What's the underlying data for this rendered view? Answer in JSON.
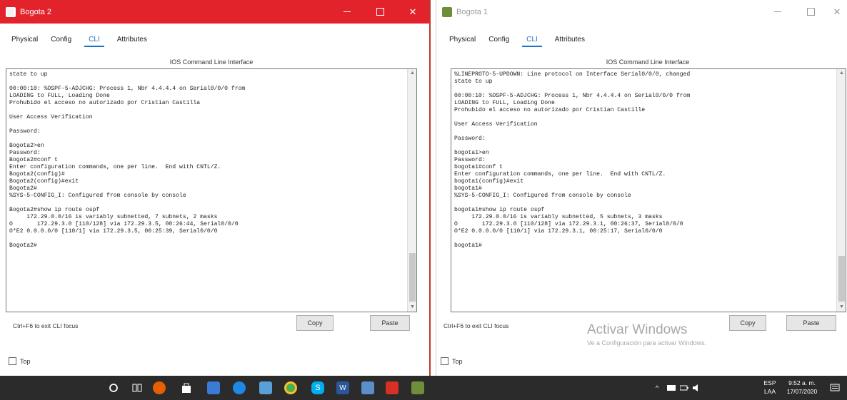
{
  "left_window": {
    "title": "Bogota 2",
    "controls": {
      "minimize": "—",
      "maximize": "□",
      "close": "✕"
    },
    "tabs": [
      "Physical",
      "Config",
      "CLI",
      "Attributes"
    ],
    "selected_tab": "CLI",
    "cli_caption": "IOS Command Line Interface",
    "terminal_lines": [
      "state to up",
      "",
      "00:00:10: %OSPF-5-ADJCHG: Process 1, Nbr 4.4.4.4 on Serial0/0/0 from",
      "LOADING to FULL, Loading Done",
      "Prohubido el acceso no autorizado por Cristian Castilla",
      "",
      "User Access Verification",
      "",
      "Password:",
      "",
      "Bogota2>en",
      "Password:",
      "Bogota2#conf t",
      "Enter configuration commands, one per line.  End with CNTL/Z.",
      "Bogota2(config)#",
      "Bogota2(config)#exit",
      "Bogota2#",
      "%SYS-5-CONFIG_I: Configured from console by console",
      "",
      "Bogota2#show ip route ospf",
      "     172.29.0.0/16 is variably subnetted, 7 subnets, 2 masks",
      "O       172.29.3.0 [110/128] via 172.29.3.5, 00:26:44, Serial0/0/0",
      "O*E2 0.0.0.0/0 [110/1] via 172.29.3.5, 00:25:39, Serial0/0/0",
      "",
      "Bogota2#"
    ],
    "hint": "Ctrl+F6 to exit CLI focus",
    "copy_label": "Copy",
    "paste_label": "Paste",
    "top_label": "Top"
  },
  "right_window": {
    "title": "Bogota 1",
    "controls": {
      "minimize": "—",
      "maximize": "□",
      "close": "✕"
    },
    "tabs": [
      "Physical",
      "Config",
      "CLI",
      "Attributes"
    ],
    "selected_tab": "CLI",
    "cli_caption": "IOS Command Line Interface",
    "terminal_lines": [
      "%LINEPROTO-5-UPDOWN: Line protocol on Interface Serial0/0/0, changed",
      "state to up",
      "",
      "00:00:10: %OSPF-5-ADJCHG: Process 1, Nbr 4.4.4.4 on Serial0/0/0 from",
      "LOADING to FULL, Loading Done",
      "Prohubido el acceso no autorizado por Cristian Castille",
      "",
      "User Access Verification",
      "",
      "Password:",
      "",
      "bogota1>en",
      "Password:",
      "bogota1#conf t",
      "Enter configuration commands, one per line.  End with CNTL/Z.",
      "bogota1(config)#exit",
      "bogota1#",
      "%SYS-5-CONFIG_I: Configured from console by console",
      "",
      "bogota1#show ip route ospf",
      "     172.29.0.0/16 is variably subnetted, 5 subnets, 3 masks",
      "O       172.29.3.0 [110/128] via 172.29.3.1, 00:26:37, Serial0/0/0",
      "O*E2 0.0.0.0/0 [110/1] via 172.29.3.1, 00:25:17, Serial0/0/0",
      "",
      "bogota1#"
    ],
    "hint": "Ctrl+F6 to exit CLI focus",
    "copy_label": "Copy",
    "paste_label": "Paste",
    "top_label": "Top"
  },
  "watermark": {
    "title": "Activar Windows",
    "subtitle": "Ve a Configuración para activar Windows."
  },
  "taskbar": {
    "icons": [
      "start-search-icon",
      "task-view-icon",
      "firefox-icon",
      "store-icon",
      "mail-icon",
      "edge-icon",
      "media-icon",
      "chrome-icon",
      "skype-icon",
      "word-icon",
      "packet-tracer-icon",
      "pdf-icon",
      "game-icon"
    ],
    "tray_chevron": "^",
    "lang_top": "ESP",
    "lang_bottom": "LAA",
    "time": "9:52 a. m.",
    "date": "17/07/2020"
  },
  "colors": {
    "active_titlebar": "#e3232c",
    "selected_tab": "#1a73c7",
    "taskbar": "#2b2b2b"
  }
}
